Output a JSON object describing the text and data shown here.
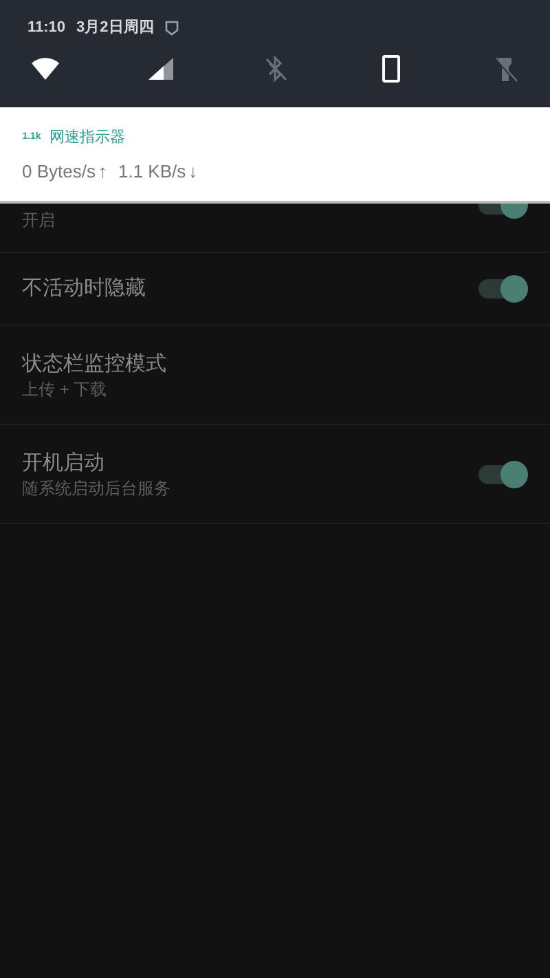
{
  "status_bar": {
    "time": "11:10",
    "date": "3月2日周四"
  },
  "quick_settings": [
    {
      "kind": "wifi",
      "on": true
    },
    {
      "kind": "signal",
      "on": true
    },
    {
      "kind": "bluetooth",
      "on": false
    },
    {
      "kind": "rotation",
      "on": true
    },
    {
      "kind": "flashlight",
      "on": false
    }
  ],
  "notification": {
    "app_name": "网速指示器",
    "icon_text": "1.1k",
    "upload": "0 Bytes/s",
    "upload_arrow": "↑",
    "download": "1.1 KB/s",
    "download_arrow": "↓"
  },
  "settings": [
    {
      "subtitle": "开启",
      "kind": "toggle",
      "on": true,
      "partial": true
    },
    {
      "title": "不活动时隐藏",
      "kind": "toggle",
      "on": true
    },
    {
      "title": "状态栏监控模式",
      "subtitle": "上传 + 下载",
      "kind": "plain"
    },
    {
      "title": "开机启动",
      "subtitle": "随系统启动后台服务",
      "kind": "toggle",
      "on": true
    }
  ]
}
